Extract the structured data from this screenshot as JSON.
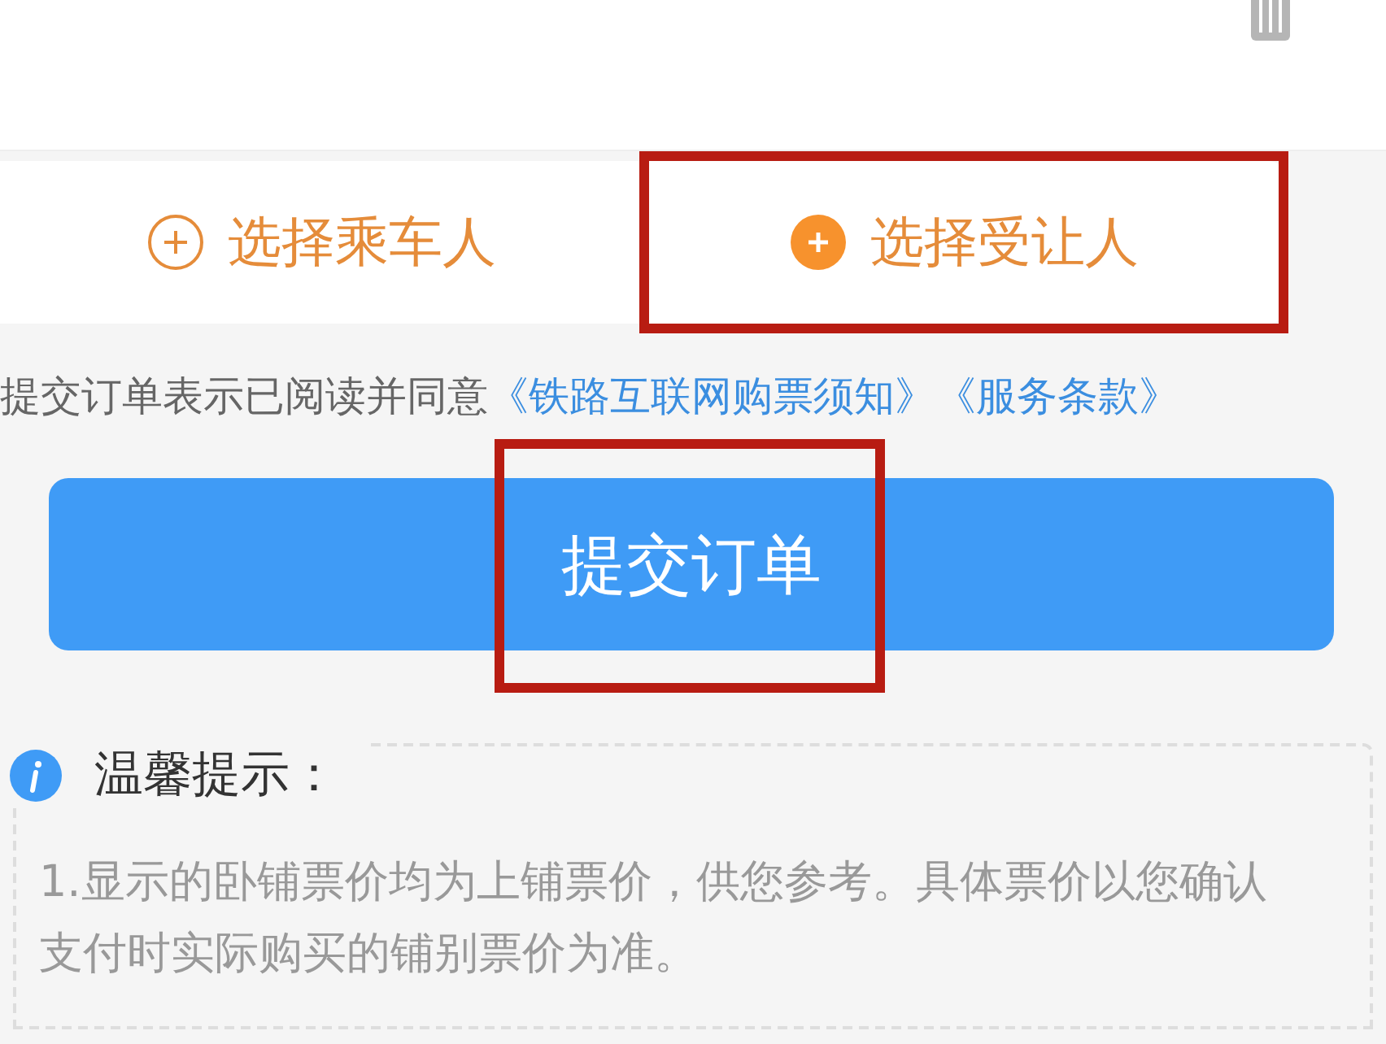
{
  "actions": [
    {
      "label": "选择乘车人",
      "kind": "outline",
      "highlighted": false
    },
    {
      "label": "选择受让人",
      "kind": "filled",
      "highlighted": true
    }
  ],
  "agreement": {
    "text": "提交订单表示已阅读并同意",
    "links": [
      "《铁路互联网购票须知》",
      "《服务条款》"
    ]
  },
  "submit": {
    "label": "提交订单",
    "highlighted": true
  },
  "tips": {
    "title": "温馨提示：",
    "lines": [
      "1.显示的卧铺票价均为上铺票价，供您参考。具体票价以您确认支付时实际购买的铺别票价为准。"
    ]
  }
}
